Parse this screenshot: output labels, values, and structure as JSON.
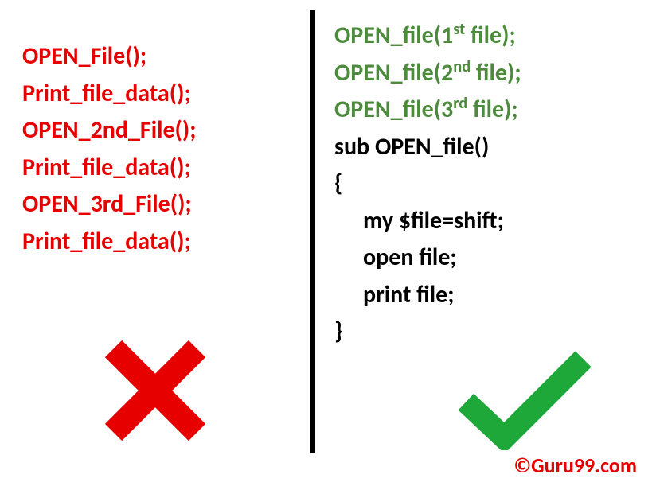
{
  "left": {
    "lines": [
      "OPEN_File();",
      "Print_file_data();",
      "OPEN_2nd_File();",
      "Print_file_data();",
      "OPEN_3rd_File();",
      "Print_file_data();"
    ]
  },
  "right": {
    "call1_pre": "OPEN_file(1",
    "call1_sup": "st",
    "call1_post": " file);",
    "call2_pre": "OPEN_file(2",
    "call2_sup": "nd",
    "call2_post": "  file);",
    "call3_pre": "OPEN_file(3",
    "call3_sup": "rd",
    "call3_post": " file);",
    "def_line": "sub OPEN_file()",
    "brace_open": "{",
    "body1": "my $file=shift;",
    "body2": "open file;",
    "body3": "print file;",
    "brace_close": "}"
  },
  "icons": {
    "cross_color": "#e60000",
    "check_color": "#1fa83a"
  },
  "copyright": "©Guru99.com"
}
